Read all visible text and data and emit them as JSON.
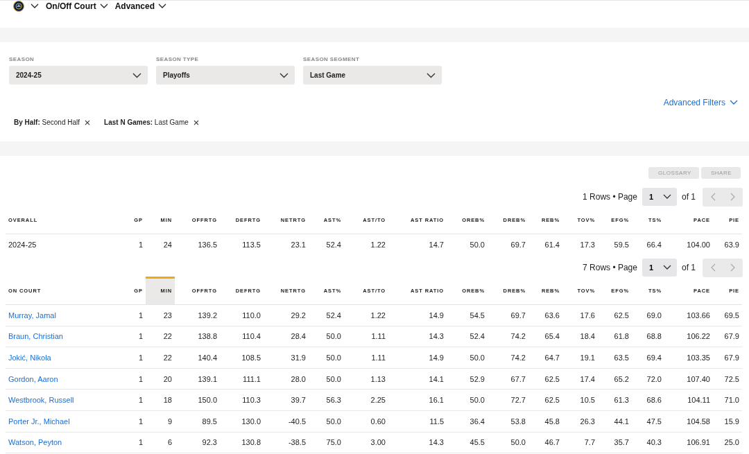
{
  "nav": {
    "menus": [
      {
        "label": "On/Off Court"
      },
      {
        "label": "Advanced"
      }
    ]
  },
  "filters": [
    {
      "label": "SEASON",
      "value": "2024-25"
    },
    {
      "label": "SEASON TYPE",
      "value": "Playoffs"
    },
    {
      "label": "SEASON SEGMENT",
      "value": "Last Game"
    }
  ],
  "advanced_filters": "Advanced Filters",
  "active_filters": [
    {
      "label": "By Half:",
      "value": "Second Half"
    },
    {
      "label": "Last N Games:",
      "value": "Last Game"
    }
  ],
  "actions": [
    "GLOSSARY",
    "SHARE"
  ],
  "tables": [
    {
      "kind": "summary",
      "pagination": {
        "rows": "1 Rows • Page",
        "page": "1",
        "of": "of 1"
      },
      "columns": [
        {
          "label": "OVERALL",
          "sorted": false
        },
        {
          "label": "GP",
          "sorted": false
        },
        {
          "label": "MIN",
          "sorted": false
        },
        {
          "label": "OFFRTG",
          "sorted": false
        },
        {
          "label": "DEFRTG",
          "sorted": false
        },
        {
          "label": "NETRTG",
          "sorted": false
        },
        {
          "label": "AST%",
          "sorted": false
        },
        {
          "label": "AST/TO",
          "sorted": false
        },
        {
          "label": "AST RATIO",
          "sorted": false
        },
        {
          "label": "OREB%",
          "sorted": false
        },
        {
          "label": "DREB%",
          "sorted": false
        },
        {
          "label": "REB%",
          "sorted": false
        },
        {
          "label": "TOV%",
          "sorted": false
        },
        {
          "label": "EFG%",
          "sorted": false
        },
        {
          "label": "TS%",
          "sorted": false
        },
        {
          "label": "PACE",
          "sorted": false
        },
        {
          "label": "PIE",
          "sorted": false
        }
      ],
      "rows": [
        [
          "2024-25",
          "1",
          "24",
          "136.5",
          "113.5",
          "23.1",
          "52.4",
          "1.22",
          "14.7",
          "50.0",
          "69.7",
          "61.4",
          "17.3",
          "59.5",
          "66.4",
          "104.00",
          "63.9"
        ]
      ]
    },
    {
      "kind": "players",
      "pagination": {
        "rows": "7 Rows • Page",
        "page": "1",
        "of": "of 1"
      },
      "columns": [
        {
          "label": "ON COURT",
          "sorted": false
        },
        {
          "label": "GP",
          "sorted": false
        },
        {
          "label": "MIN",
          "sorted": true
        },
        {
          "label": "OFFRTG",
          "sorted": false
        },
        {
          "label": "DEFRTG",
          "sorted": false
        },
        {
          "label": "NETRTG",
          "sorted": false
        },
        {
          "label": "AST%",
          "sorted": false
        },
        {
          "label": "AST/TO",
          "sorted": false
        },
        {
          "label": "AST RATIO",
          "sorted": false
        },
        {
          "label": "OREB%",
          "sorted": false
        },
        {
          "label": "DREB%",
          "sorted": false
        },
        {
          "label": "REB%",
          "sorted": false
        },
        {
          "label": "TOV%",
          "sorted": false
        },
        {
          "label": "EFG%",
          "sorted": false
        },
        {
          "label": "TS%",
          "sorted": false
        },
        {
          "label": "PACE",
          "sorted": false
        },
        {
          "label": "PIE",
          "sorted": false
        }
      ],
      "rows": [
        [
          "Murray, Jamal",
          "1",
          "23",
          "139.2",
          "110.0",
          "29.2",
          "52.4",
          "1.22",
          "14.9",
          "54.5",
          "69.7",
          "63.6",
          "17.6",
          "62.5",
          "69.0",
          "103.66",
          "69.5"
        ],
        [
          "Braun, Christian",
          "1",
          "22",
          "138.8",
          "110.4",
          "28.4",
          "50.0",
          "1.11",
          "14.3",
          "52.4",
          "74.2",
          "65.4",
          "18.4",
          "61.8",
          "68.8",
          "106.22",
          "67.9"
        ],
        [
          "Jokić, Nikola",
          "1",
          "22",
          "140.4",
          "108.5",
          "31.9",
          "50.0",
          "1.11",
          "14.9",
          "50.0",
          "74.2",
          "64.7",
          "19.1",
          "63.5",
          "69.4",
          "103.35",
          "67.9"
        ],
        [
          "Gordon, Aaron",
          "1",
          "20",
          "139.1",
          "111.1",
          "28.0",
          "50.0",
          "1.13",
          "14.1",
          "52.9",
          "67.7",
          "62.5",
          "17.4",
          "65.2",
          "72.0",
          "107.40",
          "72.5"
        ],
        [
          "Westbrook, Russell",
          "1",
          "18",
          "150.0",
          "110.3",
          "39.7",
          "56.3",
          "2.25",
          "16.1",
          "50.0",
          "72.7",
          "62.5",
          "10.5",
          "61.3",
          "68.6",
          "104.11",
          "71.0"
        ],
        [
          "Porter Jr., Michael",
          "1",
          "9",
          "89.5",
          "130.0",
          "-40.5",
          "50.0",
          "0.60",
          "11.5",
          "36.4",
          "53.8",
          "45.8",
          "26.3",
          "44.1",
          "47.5",
          "104.58",
          "15.9"
        ],
        [
          "Watson, Peyton",
          "1",
          "6",
          "92.3",
          "130.8",
          "-38.5",
          "75.0",
          "3.00",
          "14.3",
          "45.5",
          "50.0",
          "46.7",
          "7.7",
          "35.7",
          "40.3",
          "106.91",
          "25.0"
        ]
      ]
    }
  ]
}
